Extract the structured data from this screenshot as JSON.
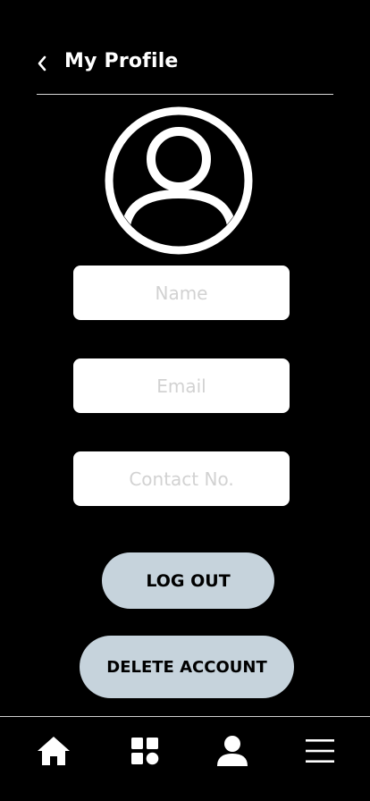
{
  "header": {
    "title": "My Profile",
    "back_icon": "chevron-left-icon"
  },
  "avatar": {
    "icon": "user-circle-icon"
  },
  "form": {
    "name_placeholder": "Name",
    "email_placeholder": "Email",
    "contact_placeholder": "Contact No."
  },
  "actions": {
    "logout_label": "LOG OUT",
    "delete_label": "DELETE ACCOUNT"
  },
  "bottom_nav": {
    "items": [
      {
        "icon": "home-icon"
      },
      {
        "icon": "grid-icon"
      },
      {
        "icon": "profile-icon"
      },
      {
        "icon": "menu-icon"
      }
    ]
  },
  "colors": {
    "background": "#000000",
    "button": "#c6d3dc",
    "field": "#ffffff",
    "placeholder": "#d2d2d2"
  }
}
